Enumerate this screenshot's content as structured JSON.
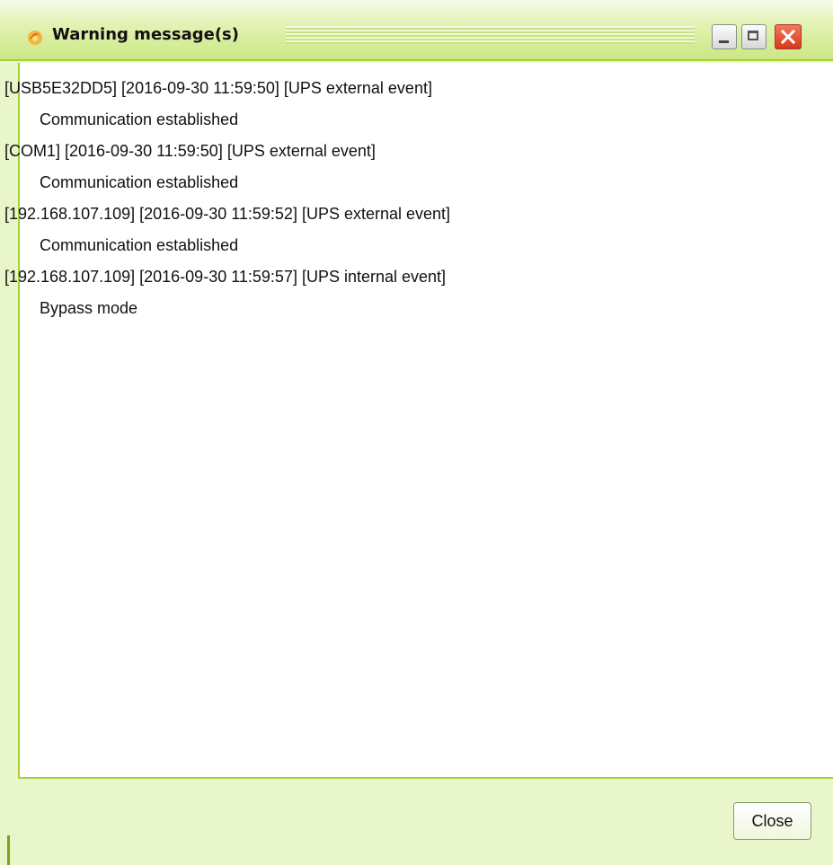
{
  "window": {
    "title": "Warning message(s)",
    "icon": "warning-flame-icon",
    "controls": {
      "minimize": "minimize-icon",
      "maximize": "maximize-icon",
      "close": "close-icon"
    }
  },
  "messages": [
    {
      "header": "[USB5E32DD5] [2016-09-30 11:59:50] [UPS external event]",
      "body": "Communication established"
    },
    {
      "header": "[COM1] [2016-09-30 11:59:50] [UPS external event]",
      "body": "Communication established"
    },
    {
      "header": "[192.168.107.109] [2016-09-30 11:59:52] [UPS external event]",
      "body": "Communication established"
    },
    {
      "header": "[192.168.107.109] [2016-09-30 11:59:57] [UPS internal event]",
      "body": "Bypass mode"
    }
  ],
  "footer": {
    "close_label": "Close"
  },
  "colors": {
    "accent": "#a6cf3a",
    "panel_bg": "#e9f6c9",
    "close_control": "#d8371c"
  }
}
